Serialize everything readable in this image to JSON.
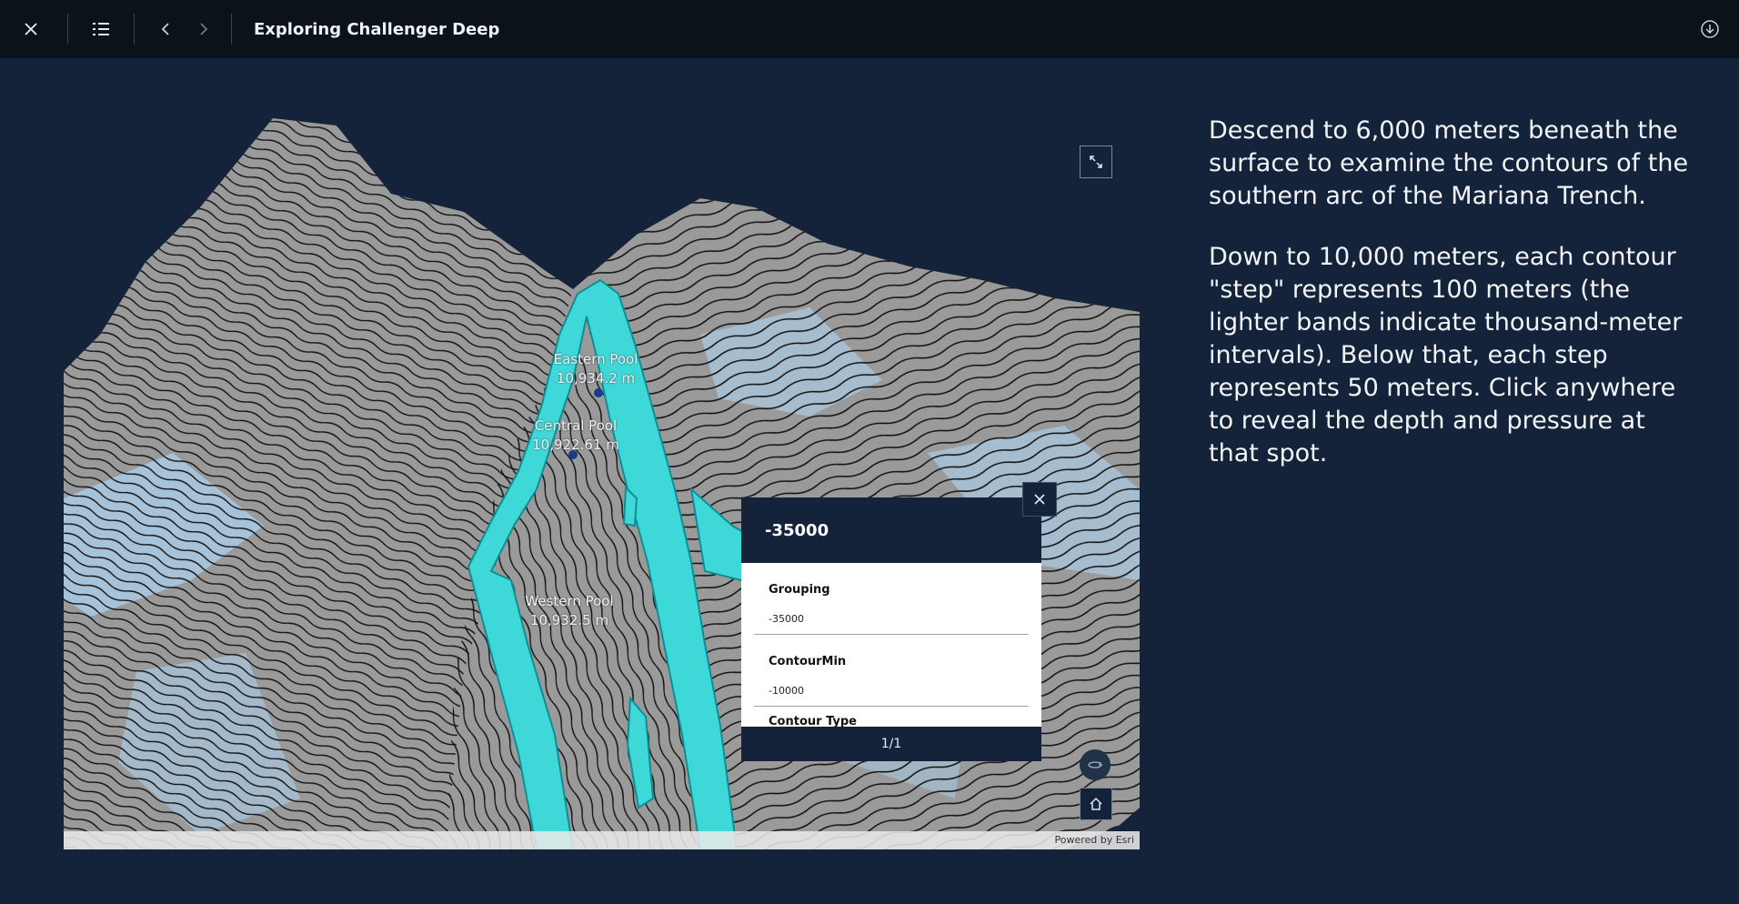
{
  "topbar": {
    "title": "Exploring Challenger Deep",
    "icons": [
      "close-icon",
      "list-icon",
      "chevron-left-icon",
      "chevron-right-icon",
      "download-icon"
    ]
  },
  "map": {
    "labels": [
      {
        "name": "Eastern Pool",
        "depth": "10,934.2 m"
      },
      {
        "name": "Central Pool",
        "depth": "10,922.61 m"
      },
      {
        "name": "Western Pool",
        "depth": "10,932.5 m"
      }
    ],
    "attribution": "Powered by Esri",
    "colors": {
      "trench_highlight": "#3fd8d8",
      "terrain_gray": "#9a9a9a",
      "terrain_blue": "#a8c8e0",
      "contour_line": "#111111"
    }
  },
  "popup": {
    "title": "-35000",
    "fields": [
      {
        "label": "Grouping",
        "value": "-35000"
      },
      {
        "label": "ContourMin",
        "value": "-10000"
      },
      {
        "label": "Contour Type",
        "value": ""
      }
    ],
    "pagination": "1/1"
  },
  "story": {
    "paragraphs": [
      "Descend to 6,000 meters beneath the surface to examine the contours of the southern arc of the Mariana Trench.",
      "Down to 10,000 meters, each contour \"step\" represents 100 meters (the lighter bands indicate thousand-meter intervals). Below that, each step represents 50 meters. Click anywhere to reveal the depth and pressure at that spot."
    ]
  }
}
